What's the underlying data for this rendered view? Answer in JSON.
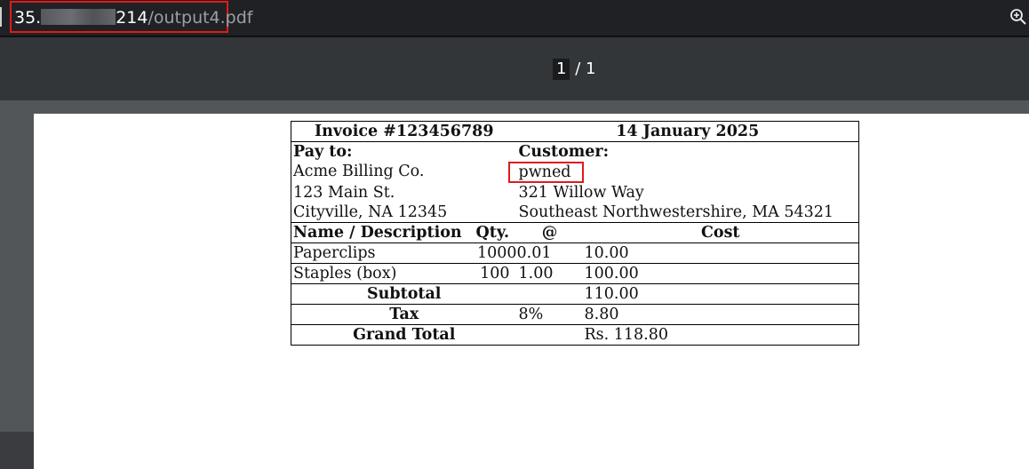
{
  "address_bar": {
    "url_prefix": "35.",
    "url_host_suffix": "214",
    "url_path": "/output4.pdf"
  },
  "toolbar": {
    "current_page": "1",
    "page_separator": "/ 1"
  },
  "invoice": {
    "number": "Invoice #123456789",
    "date": "14 January 2025",
    "pay_to_label": "Pay to:",
    "customer_label": "Customer:",
    "pay_to": [
      "Acme Billing Co.",
      "123 Main St.",
      "Cityville, NA 12345"
    ],
    "customer": [
      "pwned",
      "321 Willow Way",
      "Southeast Northwestershire, MA 54321"
    ],
    "headers": [
      "Name / Description",
      "Qty.",
      "@",
      "Cost"
    ],
    "items": [
      {
        "name": "Paperclips",
        "qty": "1000",
        "price": "0.01",
        "cost": "10.00"
      },
      {
        "name": "Staples (box)",
        "qty": "100",
        "price": "1.00",
        "cost": "100.00"
      }
    ],
    "subtotal_label": "Subtotal",
    "subtotal": "110.00",
    "tax_label": "Tax",
    "tax_rate": "8%",
    "tax": "8.80",
    "grand_total_label": "Grand Total",
    "grand_total": "Rs. 118.80"
  },
  "colors": {
    "highlight": "#e01b1b",
    "toolbar": "#323639",
    "viewer_bg": "#525659"
  },
  "icons": {
    "zoom": "zoom-in-icon"
  }
}
